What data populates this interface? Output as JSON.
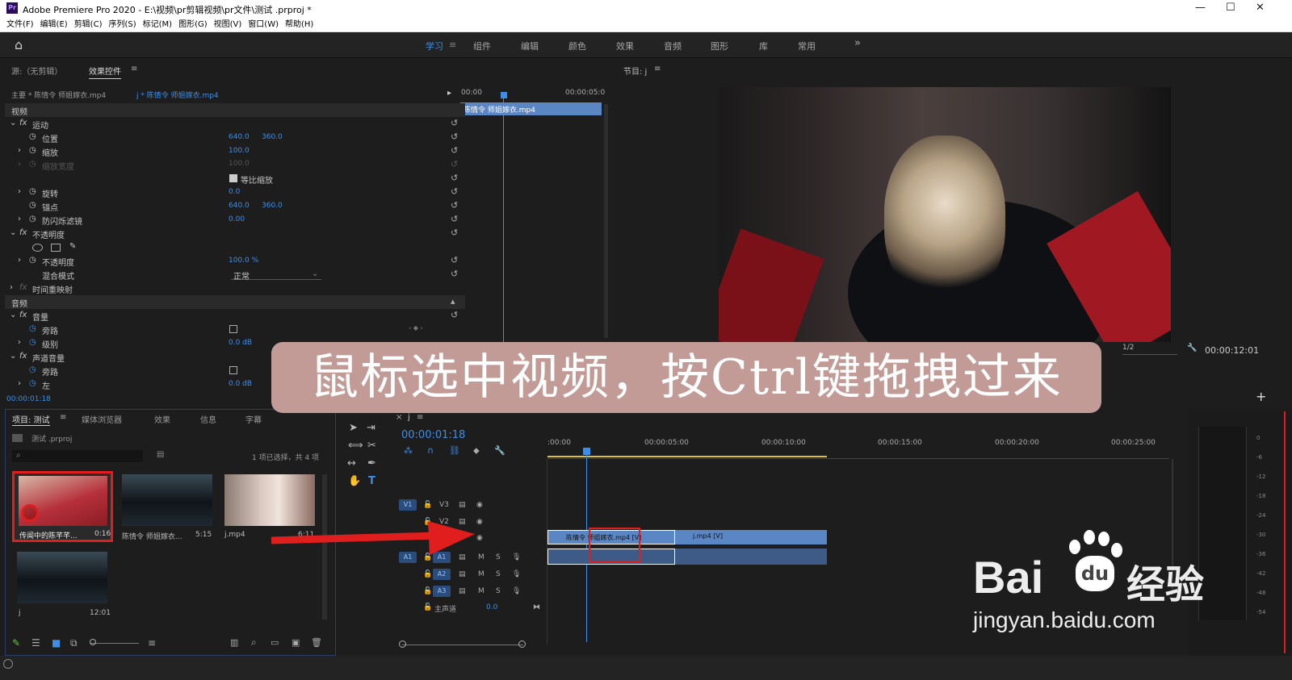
{
  "window": {
    "title": "Adobe Premiere Pro 2020 - E:\\视频\\pr剪辑视频\\pr文件\\测试 .prproj *",
    "logo": "Pr"
  },
  "menu": [
    "文件(F)",
    "编辑(E)",
    "剪辑(C)",
    "序列(S)",
    "标记(M)",
    "图形(G)",
    "视图(V)",
    "窗口(W)",
    "帮助(H)"
  ],
  "workspaces": [
    "学习",
    "组件",
    "编辑",
    "颜色",
    "效果",
    "音频",
    "图形",
    "库",
    "常用"
  ],
  "source_panel": {
    "tab_source": "源:（无剪辑）",
    "tab_effects": "效果控件",
    "master": "主要 * 陈情令 师姐嫁衣.mp4",
    "clip": "j * 陈情令 师姐嫁衣.mp4",
    "time_start": "00:00",
    "time_end": "00:00:05:0",
    "clip_label": "陈情令 师姐嫁衣.mp4",
    "timecode": "00:00:01:18"
  },
  "effects": {
    "video": "视频",
    "motion": "运动",
    "position": "位置",
    "pos_x": "640.0",
    "pos_y": "360.0",
    "scale": "缩放",
    "scale_v": "100.0",
    "scale_w": "缩放宽度",
    "scale_w_v": "100.0",
    "uniform": "等比缩放",
    "rotation": "旋转",
    "rotation_v": "0.0",
    "anchor": "锚点",
    "anchor_x": "640.0",
    "anchor_y": "360.0",
    "flicker": "防闪烁滤镜",
    "flicker_v": "0.00",
    "opacity_group": "不透明度",
    "opacity": "不透明度",
    "opacity_v": "100.0 %",
    "blend": "混合模式",
    "blend_v": "正常",
    "time_remap": "时间重映射",
    "audio": "音频",
    "volume": "音量",
    "bypass": "旁路",
    "level": "级别",
    "level_v": "0.0 dB",
    "channel_vol": "声道音量",
    "bypass2": "旁路",
    "left": "左",
    "left_v": "0.0 dB"
  },
  "program": {
    "title": "节目: j",
    "zoom": "1/2",
    "timecode": "00:00:12:01"
  },
  "project": {
    "tabs": [
      "项目: 测试",
      "媒体浏览器",
      "效果",
      "信息",
      "字幕"
    ],
    "file": "测试 .prproj",
    "selection": "1 项已选择，共 4 项",
    "items": [
      {
        "name": "传闻中的陈芊芊...",
        "dur": "0:16"
      },
      {
        "name": "陈情令 师姐嫁衣...",
        "dur": "5:15"
      },
      {
        "name": "j.mp4",
        "dur": "6:11"
      },
      {
        "name": "j",
        "dur": "12:01"
      }
    ]
  },
  "timeline": {
    "tab": "j",
    "timecode": "00:00:01:18",
    "ruler": [
      ":00:00",
      "00:00:05:00",
      "00:00:10:00",
      "00:00:15:00",
      "00:00:20:00",
      "00:00:25:00"
    ],
    "tracks_v": [
      "V3",
      "V2",
      "V1"
    ],
    "tracks_a": [
      "A1",
      "A2",
      "A3"
    ],
    "master": "主声道",
    "master_v": "0.0",
    "src_v": "V1",
    "src_a": "A1",
    "clip1": "陈情令 师姐嫁衣.mp4 [V]",
    "clip2": "j.mp4 [V]"
  },
  "meter_scale": [
    "0",
    "-6",
    "-12",
    "-18",
    "-24",
    "-30",
    "-36",
    "-42",
    "-48",
    "-54"
  ],
  "caption": "鼠标选中视频，按Ctrl键拖拽过来",
  "watermark": {
    "brand": "Bai",
    "brand2": "du",
    "cn": "经验",
    "url": "jingyan.baidu.com"
  },
  "colors": {
    "accent": "#3d8ee8",
    "clip_video": "#5b86c4",
    "highlight": "#e01e1e",
    "caption_bg": "#c29a96"
  }
}
